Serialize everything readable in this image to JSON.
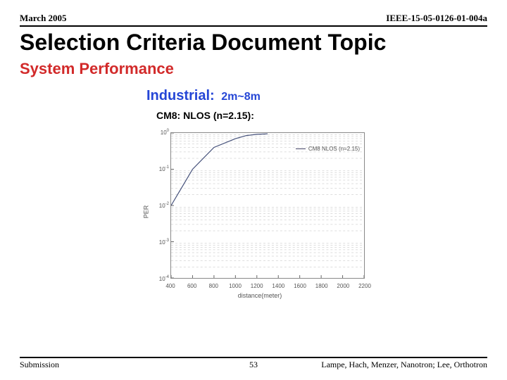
{
  "header": {
    "date": "March 2005",
    "docnum": "IEEE-15-05-0126-01-004a"
  },
  "title": "Selection Criteria Document Topic",
  "section": "System Performance",
  "industrial": {
    "label": "Industrial:",
    "range": "2m~8m"
  },
  "cm_line": "CM8: NLOS (n=2.15):",
  "chart_data": {
    "type": "line",
    "title": "",
    "xlabel": "distance(meter)",
    "ylabel": "PER",
    "xlim": [
      400,
      2200
    ],
    "ylog": true,
    "ylim_exp": [
      -4,
      0
    ],
    "x_ticks": [
      400,
      600,
      800,
      1000,
      1200,
      1400,
      1600,
      1800,
      2000,
      2200
    ],
    "y_ticks_exp": [
      0,
      -1,
      -2,
      -3,
      -4
    ],
    "legend": "CM8 NLOS (n=2.15)",
    "series": [
      {
        "name": "CM8 NLOS (n=2.15)",
        "x": [
          400,
          600,
          800,
          1000,
          1100,
          1200,
          1300
        ],
        "y": [
          0.01,
          0.1,
          0.4,
          0.7,
          0.85,
          0.92,
          0.95
        ]
      }
    ]
  },
  "footer": {
    "left": "Submission",
    "page": "53",
    "right": "Lampe, Hach, Menzer, Nanotron; Lee, Orthotron"
  }
}
